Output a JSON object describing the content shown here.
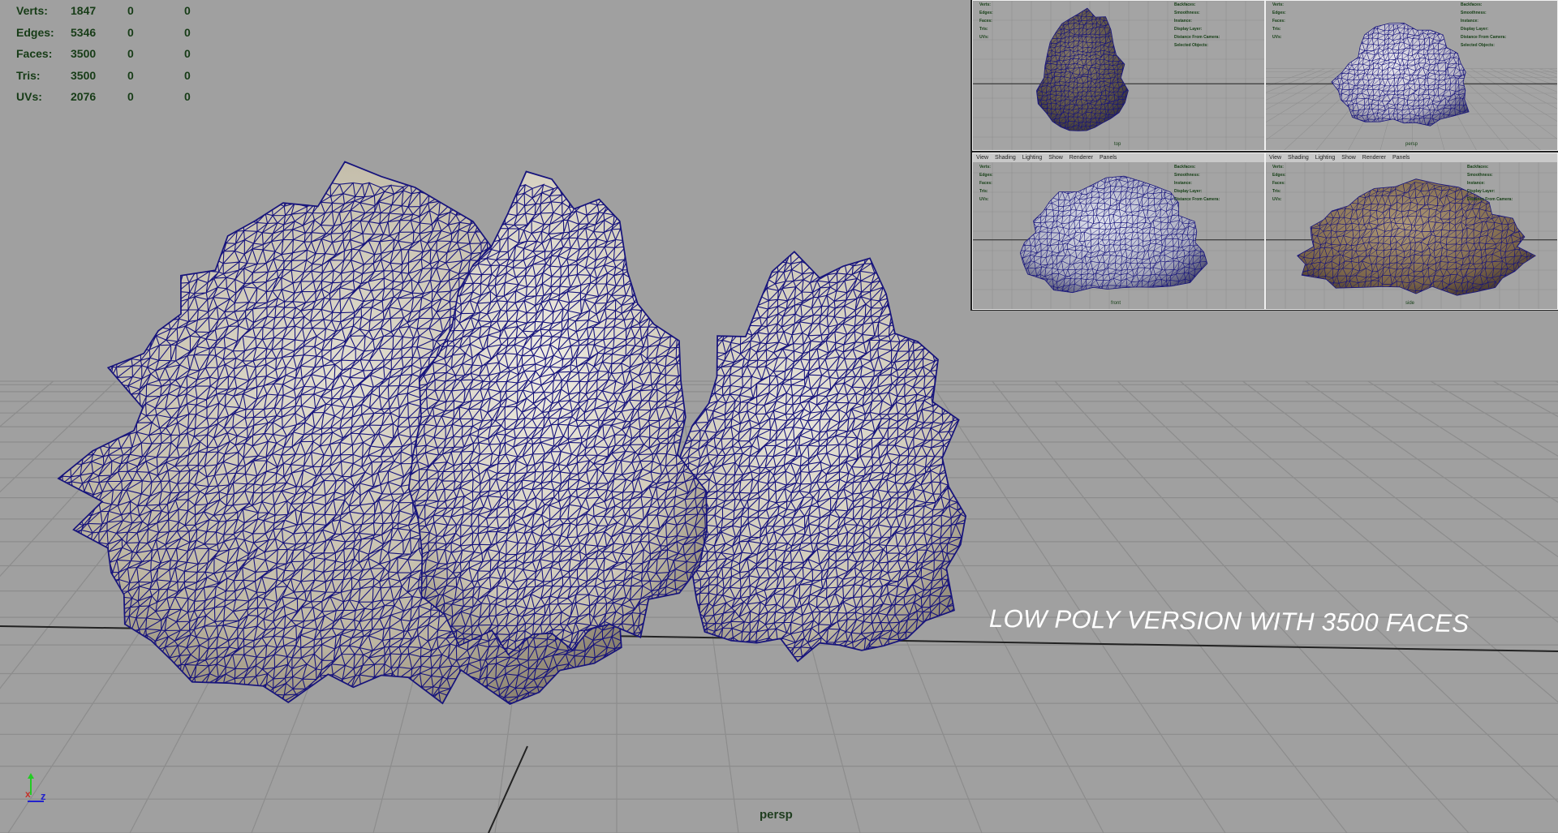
{
  "hud": {
    "rows": [
      {
        "label": "Verts:",
        "v1": "1847",
        "v2": "0",
        "v3": "0"
      },
      {
        "label": "Edges:",
        "v1": "5346",
        "v2": "0",
        "v3": "0"
      },
      {
        "label": "Faces:",
        "v1": "3500",
        "v2": "0",
        "v3": "0"
      },
      {
        "label": "Tris:",
        "v1": "3500",
        "v2": "0",
        "v3": "0"
      },
      {
        "label": "UVs:",
        "v1": "2076",
        "v2": "0",
        "v3": "0"
      }
    ]
  },
  "caption": "LOW POLY VERSION WITH 3500 FACES",
  "camera": "persp",
  "axis": {
    "x": "x",
    "z": "z"
  },
  "mini_menu": [
    "View",
    "Shading",
    "Lighting",
    "Show",
    "Renderer",
    "Panels"
  ],
  "mini_right_labels": [
    "Backfaces:",
    "Smoothness:",
    "Instance:",
    "Display Layer:",
    "Distance From Camera:",
    "Selected Objects:"
  ],
  "mini_cams": [
    "top",
    "persp",
    "front",
    "side"
  ],
  "colors": {
    "background": "#a0a0a0",
    "grid": "#8c8c8c",
    "wire": "#17147c",
    "rock": "#c9c4b4",
    "hud_text": "#173c17"
  }
}
